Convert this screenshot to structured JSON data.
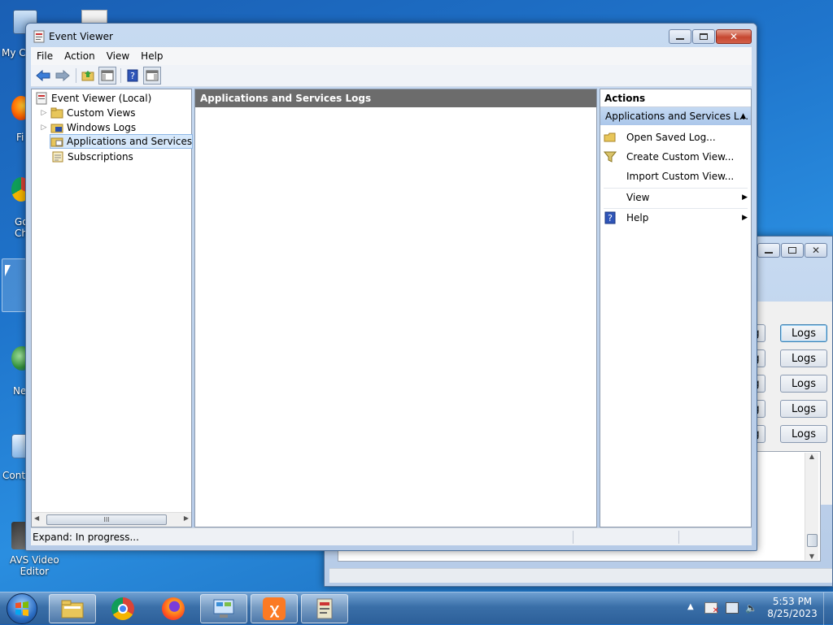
{
  "desktop": {
    "icons": [
      {
        "label": "My C"
      },
      {
        "label": "Fi"
      },
      {
        "label": "Go\nCh"
      },
      {
        "label": "Ne"
      },
      {
        "label": "Cont"
      },
      {
        "label": "AVS Video\nEditor"
      }
    ]
  },
  "main_window": {
    "title": "Event Viewer",
    "menu": [
      "File",
      "Action",
      "View",
      "Help"
    ],
    "tree": {
      "root": "Event Viewer (Local)",
      "items": [
        "Custom Views",
        "Windows Logs",
        "Applications and Services Lo",
        "Subscriptions"
      ]
    },
    "center_header": "Applications and Services Logs",
    "actions": {
      "header": "Actions",
      "section": "Applications and Services L...",
      "items": [
        "Open Saved Log...",
        "Create Custom View...",
        "Import Custom View...",
        "View",
        "Help"
      ]
    },
    "status": "Expand:  In progress...",
    "hscroll_thumb": "III"
  },
  "back_window": {
    "buttons": [
      "Logs",
      "Logs",
      "Logs",
      "Logs",
      "Logs"
    ],
    "partial_label": "g"
  },
  "taskbar": {
    "time": "5:53 PM",
    "date": "8/25/2023"
  },
  "colors": {
    "desktop": "#1f75cc",
    "header_gray": "#6c6c6c",
    "selection": "#d6e8fb"
  }
}
